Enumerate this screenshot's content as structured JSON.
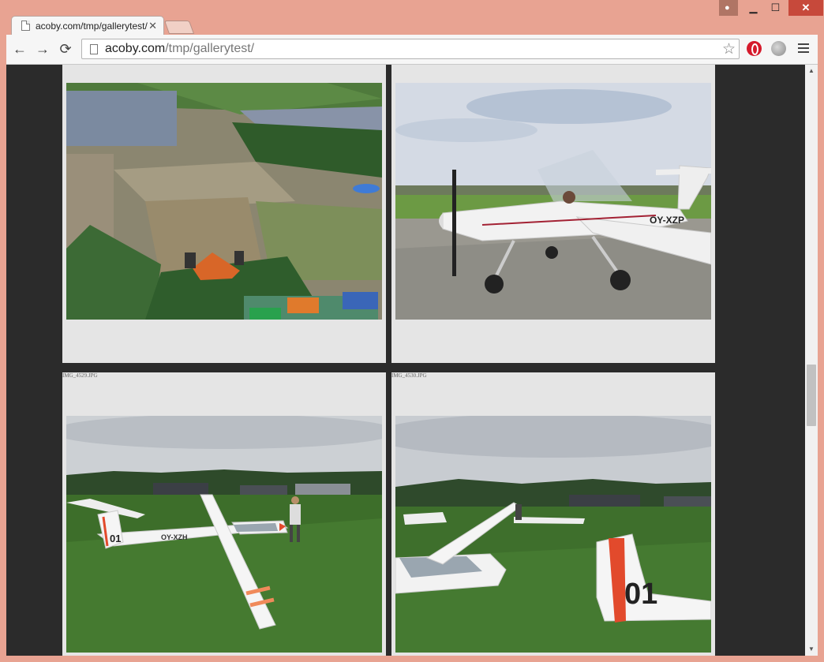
{
  "browser": {
    "tab_title": "acoby.com/tmp/gallerytest/",
    "tab_close": "✕",
    "url_host": "acoby.com",
    "url_path": "/tmp/gallerytest/",
    "back": "←",
    "forward": "→",
    "reload": "⟳",
    "star": "☆",
    "minimize": "▁",
    "maximize": "☐",
    "close": "✕"
  },
  "gallery": {
    "items": [
      {
        "caption": ""
      },
      {
        "caption": ""
      },
      {
        "caption": "IMG_4529.JPG"
      },
      {
        "caption": "IMG_4530.JPG"
      }
    ]
  },
  "scrollbar": {
    "up": "▲",
    "down": "▼",
    "position": 0.52
  }
}
